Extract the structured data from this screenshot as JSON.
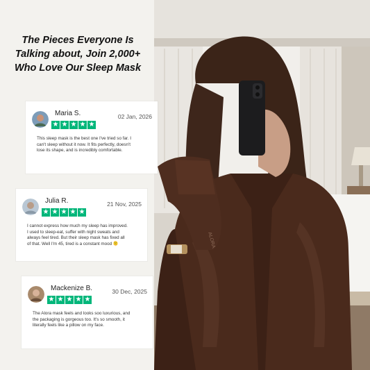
{
  "headline": "The Pieces Everyone Is Talking about, Join 2,000+ Who Love Our Sleep Mask",
  "star_glyph": "★",
  "colors": {
    "star_green": "#00b67a",
    "satin_brown": "#4a2a1c",
    "background": "#f3f2ee"
  },
  "reviews": [
    {
      "name": "Maria S.",
      "date": "02 Jan, 2026",
      "rating": 5,
      "text": "This sleep mask is the best one I've tried so far. I can't sleep without it now. It fits perfectly, doesn't lose its shape, and is incredibly comfortable."
    },
    {
      "name": "Julia R.",
      "date": "21 Nov, 2025",
      "rating": 5,
      "text": "I cannot express how much my sleep has improved. I used to sleep-eat, suffer with night sweats and always feel tired. But their sleep mask has fixed all of that. Well I'm 45, tired is a constant mood 🫠"
    },
    {
      "name": "Mackenize B.",
      "date": "30 Dec, 2025",
      "rating": 5,
      "text": "The Alora mask feels and looks soo luxurious, and the packaging is gorgeous too. It's so smooth, it literally feels like a pillow on my face."
    }
  ],
  "photo": {
    "mask_brand": "ALORA",
    "avatar_icons": [
      "avatar-icon",
      "avatar-icon",
      "avatar-icon"
    ]
  }
}
